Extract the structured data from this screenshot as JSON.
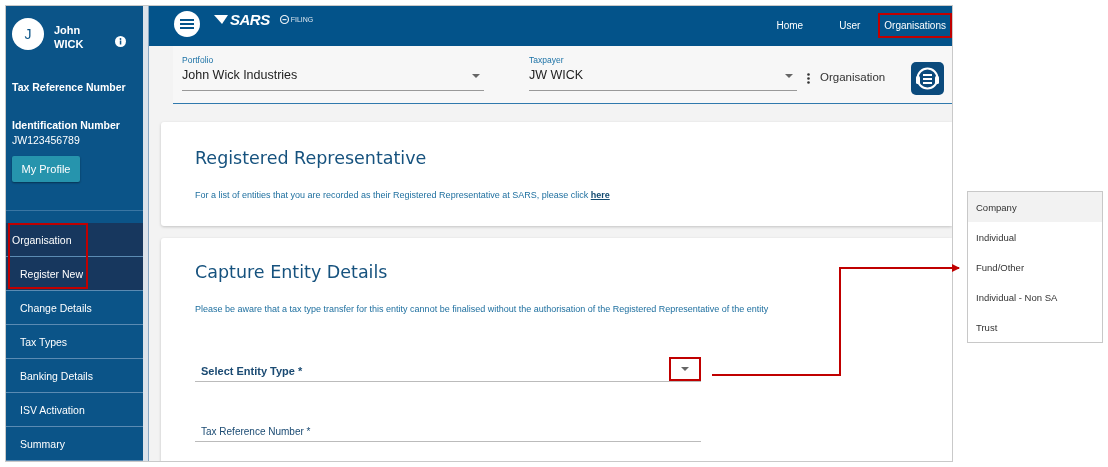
{
  "sidebar": {
    "avatar_initial": "J",
    "first_name": "John",
    "last_name": "WICK",
    "tax_reference_label": "Tax Reference Number",
    "identification_label": "Identification Number",
    "identification_number": "JW123456789",
    "profile_button": "My Profile",
    "menu": [
      {
        "label": "Organisation",
        "highlighted": true,
        "children": [
          {
            "label": "Register New",
            "selected": true
          },
          {
            "label": "Change Details",
            "selected": false
          },
          {
            "label": "Tax Types",
            "selected": false
          },
          {
            "label": "Banking Details",
            "selected": false
          },
          {
            "label": "ISV Activation",
            "selected": false
          },
          {
            "label": "Summary",
            "selected": false
          }
        ]
      }
    ]
  },
  "header": {
    "logo": "SARS",
    "logo_sub": "FILING",
    "nav": [
      {
        "label": "Home",
        "highlighted": false
      },
      {
        "label": "User",
        "highlighted": false
      },
      {
        "label": "Organisations",
        "highlighted": true
      }
    ]
  },
  "toolbar": {
    "portfolio": {
      "label": "Portfolio",
      "value": "John Wick Industries"
    },
    "taxpayer": {
      "label": "Taxpayer",
      "value": "JW WICK"
    },
    "context": "Organisation"
  },
  "registered_representative": {
    "title": "Registered Representative",
    "text": "For a list of entities that you are recorded as their Registered Representative at SARS, please click",
    "link": "here"
  },
  "capture_entity": {
    "title": "Capture Entity Details",
    "note": "Please be aware that a tax type transfer for this entity cannot be finalised without the authorisation of the Registered Representative of the entity",
    "fields": [
      {
        "kind": "select",
        "label": "Select Entity Type *",
        "highlighted": true
      },
      {
        "kind": "text",
        "label": "Tax Reference Number *"
      }
    ]
  },
  "entity_type_options": [
    {
      "label": "Company",
      "selected": true
    },
    {
      "label": "Individual",
      "selected": false
    },
    {
      "label": "Fund/Other",
      "selected": false
    },
    {
      "label": "Individual - Non SA",
      "selected": false
    },
    {
      "label": "Trust",
      "selected": false
    }
  ]
}
